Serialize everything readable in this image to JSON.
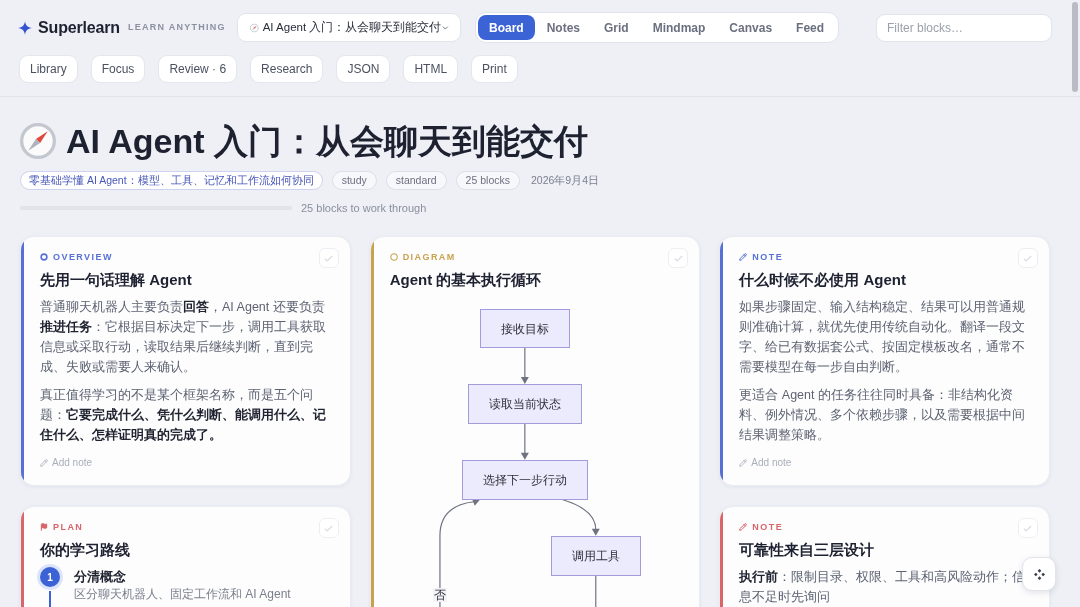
{
  "app": {
    "name": "Superlearn",
    "tagline": "LEARN ANYTHING"
  },
  "course_select": {
    "value": "AI Agent 入门：从会聊天到能交付"
  },
  "view_tabs": [
    {
      "label": "Board",
      "selected": true
    },
    {
      "label": "Notes",
      "selected": false
    },
    {
      "label": "Grid",
      "selected": false
    },
    {
      "label": "Mindmap",
      "selected": false
    },
    {
      "label": "Canvas",
      "selected": false
    },
    {
      "label": "Feed",
      "selected": false
    }
  ],
  "filter": {
    "placeholder": "Filter blocks…"
  },
  "toolbar": [
    "Library",
    "Focus",
    "Review · 6",
    "Research",
    "JSON",
    "HTML",
    "Print"
  ],
  "page": {
    "title": "AI Agent 入门：从会聊天到能交付",
    "topic": "零基础学懂 AI Agent：模型、工具、记忆和工作流如何协同",
    "tags": [
      "study",
      "standard",
      "25 blocks"
    ],
    "date": "2026年9月4日",
    "progress": {
      "level": 0,
      "label": "25 blocks to work through"
    }
  },
  "board": [
    {
      "cards": [
        {
          "kind": "overview",
          "label": "OVERVIEW",
          "color": "#5670d6",
          "done": false,
          "title": "先用一句话理解 Agent",
          "paragraphs": [
            "普通聊天机器人主要负责**回答**，AI Agent 还要负责**推进任务**：它根据目标决定下一步，调用工具获取信息或采取行动，读取结果后继续判断，直到完成、失败或需要人来确认。",
            "真正值得学习的不是某个框架名称，而是五个问题：**它要完成什么、凭什么判断、能调用什么、记住什么、怎样证明真的完成了。**"
          ],
          "add_note": "Add note"
        },
        {
          "kind": "plan",
          "label": "PLAN",
          "color": "#d9646a",
          "done": false,
          "title": "你的学习路线",
          "steps": [
            {
              "number": "1",
              "title": "分清概念",
              "text": "区分聊天机器人、固定工作流和 AI Agent"
            }
          ]
        }
      ]
    },
    {
      "cards": [
        {
          "kind": "diagram",
          "label": "DIAGRAM",
          "color": "#c9a24e",
          "done": false,
          "title": "Agent 的基本执行循环",
          "diagram": {
            "nodes": [
              {
                "label": "接收目标"
              },
              {
                "label": "读取当前状态"
              },
              {
                "label": "选择下一步行动"
              },
              {
                "label": "调用工具"
              }
            ],
            "edge_labels": [
              "否"
            ]
          }
        }
      ]
    },
    {
      "cards": [
        {
          "kind": "note",
          "label": "NOTE",
          "color": "#5670d6",
          "done": false,
          "title": "什么时候不必使用 Agent",
          "paragraphs": [
            "如果步骤固定、输入结构稳定、结果可以用普通规则准确计算，就优先使用传统自动化。翻译一段文字、给已有数据套公式、按固定模板改名，通常不需要模型在每一步自由判断。",
            "更适合 Agent 的任务往往同时具备：非结构化资料、例外情况、多个依赖步骤，以及需要根据中间结果调整策略。"
          ],
          "add_note": "Add note"
        },
        {
          "kind": "note",
          "label": "NOTE",
          "color": "#d9646a",
          "done": false,
          "title": "可靠性来自三层设计",
          "paragraphs": [
            "**执行前**：限制目录、权限、工具和高风险动作；信息不足时先询问"
          ]
        }
      ]
    }
  ]
}
